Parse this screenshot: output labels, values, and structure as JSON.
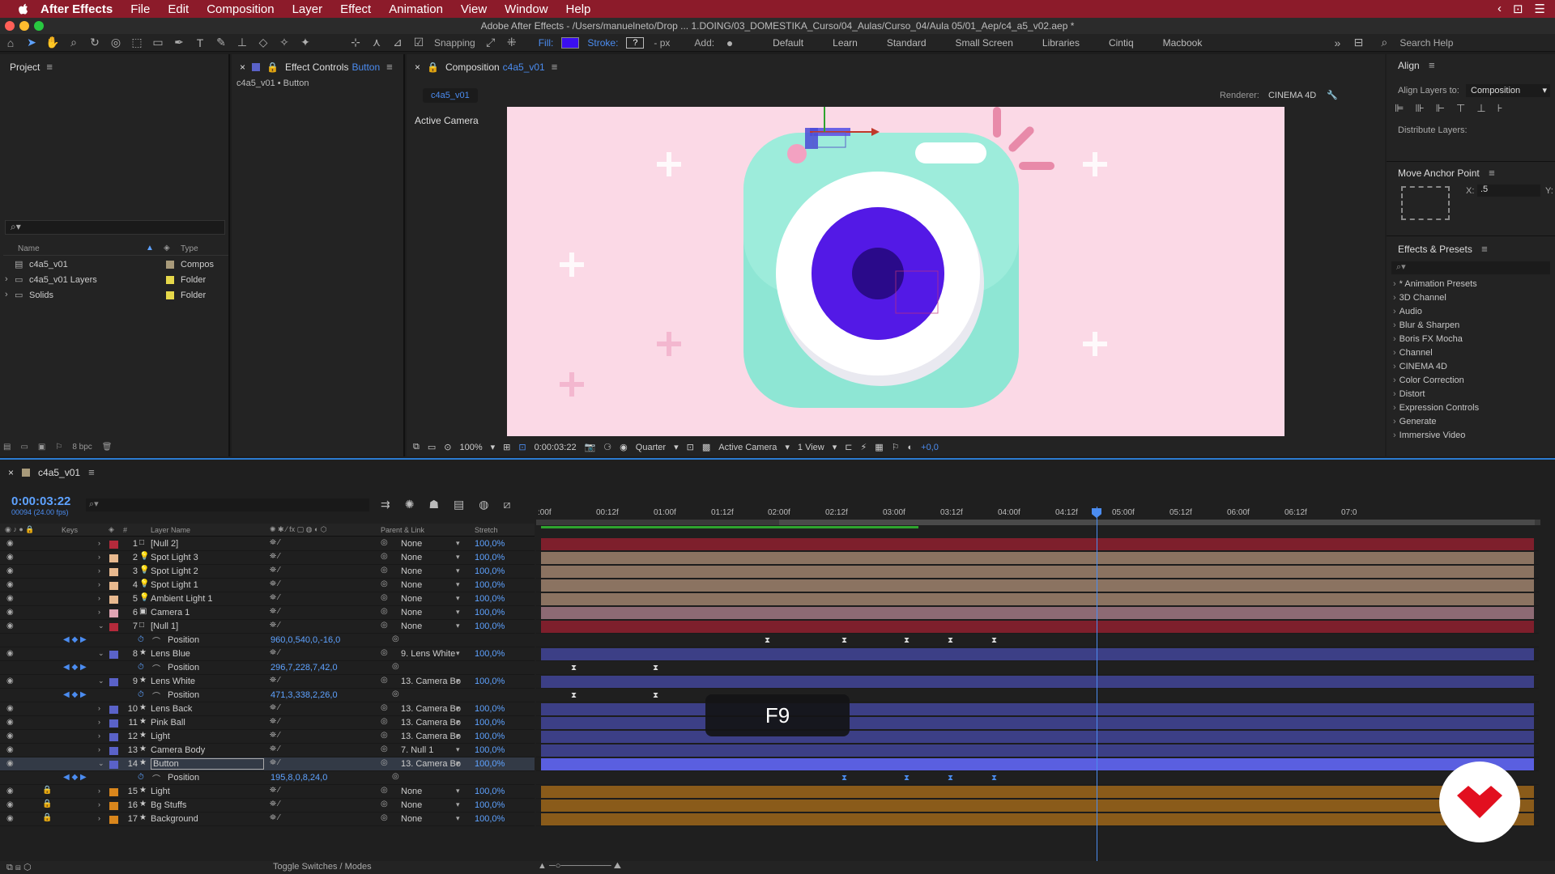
{
  "menubar": {
    "app_name": "After Effects",
    "items": [
      "File",
      "Edit",
      "Composition",
      "Layer",
      "Effect",
      "Animation",
      "View",
      "Window",
      "Help"
    ]
  },
  "titlebar": {
    "title": "Adobe After Effects - /Users/manuelneto/Drop ... 1.DOING/03_DOMESTIKA_Curso/04_Aulas/Curso_04/Aula 05/01_Aep/c4_a5_v02.aep *"
  },
  "toolbar": {
    "snapping": "Snapping",
    "fill_label": "Fill:",
    "stroke_label": "Stroke:",
    "stroke_value": "?",
    "px": "- px",
    "add_label": "Add:",
    "workspaces": [
      "Default",
      "Learn",
      "Standard",
      "Small Screen",
      "Libraries",
      "Cintiq",
      "Macbook"
    ],
    "search_help": "Search Help",
    "fill_color": "#3b0ff0"
  },
  "project": {
    "title": "Project",
    "col_name": "Name",
    "col_type": "Type",
    "items": [
      {
        "name": "c4a5_v01",
        "type": "Compos",
        "color": "#a89a7a"
      },
      {
        "name": "c4a5_v01 Layers",
        "type": "Folder",
        "color": "#e6d84a"
      },
      {
        "name": "Solids",
        "type": "Folder",
        "color": "#e6d84a"
      }
    ],
    "bpc": "8 bpc"
  },
  "effect_controls": {
    "title": "Effect Controls",
    "target": "Button",
    "sub": "c4a5_v01 • Button"
  },
  "composition": {
    "title": "Composition",
    "name": "c4a5_v01",
    "tab": "c4a5_v01",
    "renderer_label": "Renderer:",
    "renderer_value": "CINEMA 4D",
    "active_camera": "Active Camera",
    "footer": {
      "zoom": "100%",
      "timecode": "0:00:03:22",
      "resolution": "Quarter",
      "camera": "Active Camera",
      "view": "1 View",
      "exposure": "+0,0"
    }
  },
  "align": {
    "title": "Align",
    "align_to_label": "Align Layers to:",
    "align_to_value": "Composition",
    "distribute": "Distribute Layers:"
  },
  "anchor": {
    "title": "Move Anchor Point",
    "x_label": "X:",
    "x_value": ".5",
    "y_label": "Y:"
  },
  "effects_presets": {
    "title": "Effects & Presets",
    "items": [
      "* Animation Presets",
      "3D Channel",
      "Audio",
      "Blur & Sharpen",
      "Boris FX Mocha",
      "Channel",
      "CINEMA 4D",
      "Color Correction",
      "Distort",
      "Expression Controls",
      "Generate",
      "Immersive Video"
    ]
  },
  "timeline": {
    "comp_name": "c4a5_v01",
    "timecode": "0:00:03:22",
    "frames": "00094 (24.00 fps)",
    "col_keys": "Keys",
    "col_num": "#",
    "col_layer": "Layer Name",
    "col_parent": "Parent & Link",
    "col_stretch": "Stretch",
    "ruler": [
      ":00f",
      "00:12f",
      "01:00f",
      "01:12f",
      "02:00f",
      "02:12f",
      "03:00f",
      "03:12f",
      "04:00f",
      "04:12f",
      "05:00f",
      "05:12f",
      "06:00f",
      "06:12f",
      "07:0"
    ],
    "toggle": "Toggle Switches / Modes",
    "rows": [
      {
        "kind": "layer",
        "num": "1",
        "name": "[Null 2]",
        "parent": "None",
        "stretch": "100,0%",
        "color": "#b52a3b",
        "bar": "#7e1f2c",
        "icon": "□"
      },
      {
        "kind": "layer",
        "num": "2",
        "name": "Spot Light 3",
        "parent": "None",
        "stretch": "100,0%",
        "color": "#e8b98f",
        "bar": "#8b7361",
        "icon": "💡"
      },
      {
        "kind": "layer",
        "num": "3",
        "name": "Spot Light 2",
        "parent": "None",
        "stretch": "100,0%",
        "color": "#e8b98f",
        "bar": "#8b7361",
        "icon": "💡"
      },
      {
        "kind": "layer",
        "num": "4",
        "name": "Spot Light 1",
        "parent": "None",
        "stretch": "100,0%",
        "color": "#e8b98f",
        "bar": "#8b7361",
        "icon": "💡"
      },
      {
        "kind": "layer",
        "num": "5",
        "name": "Ambient Light 1",
        "parent": "None",
        "stretch": "100,0%",
        "color": "#e8b98f",
        "bar": "#8b7361",
        "icon": "💡"
      },
      {
        "kind": "layer",
        "num": "6",
        "name": "Camera 1",
        "parent": "None",
        "stretch": "100,0%",
        "color": "#e0a4b3",
        "bar": "#8d6a74",
        "icon": "▣"
      },
      {
        "kind": "layer",
        "num": "7",
        "name": "[Null 1]",
        "parent": "None",
        "stretch": "100,0%",
        "color": "#b52a3b",
        "bar": "#7e1f2c",
        "icon": "□",
        "open": true
      },
      {
        "kind": "prop",
        "name": "Position",
        "value": "960,0,540,0,-16,0"
      },
      {
        "kind": "layer",
        "num": "8",
        "name": "Lens Blue",
        "parent": "9. Lens White",
        "stretch": "100,0%",
        "color": "#5a62c8",
        "bar": "#3c3f86",
        "icon": "★",
        "open": true
      },
      {
        "kind": "prop",
        "name": "Position",
        "value": "296,7,228,7,42,0"
      },
      {
        "kind": "layer",
        "num": "9",
        "name": "Lens White",
        "parent": "13. Camera Bo",
        "stretch": "100,0%",
        "color": "#5a62c8",
        "bar": "#3c3f86",
        "icon": "★",
        "open": true
      },
      {
        "kind": "prop",
        "name": "Position",
        "value": "471,3,338,2,26,0"
      },
      {
        "kind": "layer",
        "num": "10",
        "name": "Lens Back",
        "parent": "13. Camera Bo",
        "stretch": "100,0%",
        "color": "#5a62c8",
        "bar": "#3c3f86",
        "icon": "★"
      },
      {
        "kind": "layer",
        "num": "11",
        "name": "Pink Ball",
        "parent": "13. Camera Bo",
        "stretch": "100,0%",
        "color": "#5a62c8",
        "bar": "#3c3f86",
        "icon": "★"
      },
      {
        "kind": "layer",
        "num": "12",
        "name": "Light",
        "parent": "13. Camera Bo",
        "stretch": "100,0%",
        "color": "#5a62c8",
        "bar": "#3c3f86",
        "icon": "★"
      },
      {
        "kind": "layer",
        "num": "13",
        "name": "Camera Body",
        "parent": "7. Null 1",
        "stretch": "100,0%",
        "color": "#5a62c8",
        "bar": "#3c3f86",
        "icon": "★"
      },
      {
        "kind": "layer",
        "num": "14",
        "name": "Button",
        "parent": "13. Camera Bo",
        "stretch": "100,0%",
        "color": "#5a62c8",
        "bar": "#5a5fe0",
        "icon": "★",
        "open": true,
        "selected": true
      },
      {
        "kind": "prop",
        "name": "Position",
        "value": "195,8,0,8,24,0"
      },
      {
        "kind": "layer",
        "num": "15",
        "name": "Light",
        "parent": "None",
        "stretch": "100,0%",
        "color": "#d9861c",
        "bar": "#8a5b1a",
        "icon": "★",
        "locked": true
      },
      {
        "kind": "layer",
        "num": "16",
        "name": "Bg Stuffs",
        "parent": "None",
        "stretch": "100,0%",
        "color": "#d9861c",
        "bar": "#8a5b1a",
        "icon": "★",
        "locked": true
      },
      {
        "kind": "layer",
        "num": "17",
        "name": "Background",
        "parent": "None",
        "stretch": "100,0%",
        "color": "#d9861c",
        "bar": "#8a5b1a",
        "icon": "★",
        "locked": true
      }
    ]
  },
  "overlay": {
    "key": "F9"
  }
}
